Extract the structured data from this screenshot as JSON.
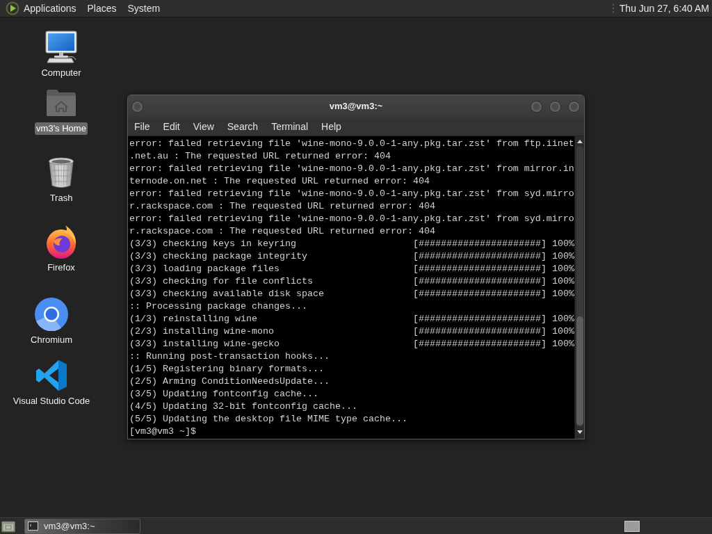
{
  "top_panel": {
    "menus": [
      "Applications",
      "Places",
      "System"
    ],
    "clock": "Thu Jun 27, 6:40 AM"
  },
  "desktop_icons": [
    {
      "label": "Computer",
      "selected": false
    },
    {
      "label": "vm3's Home",
      "selected": true
    },
    {
      "label": "Trash",
      "selected": false
    },
    {
      "label": "Firefox",
      "selected": false
    },
    {
      "label": "Chromium",
      "selected": false
    },
    {
      "label": "Visual Studio Code",
      "selected": false
    }
  ],
  "terminal_window": {
    "title": "vm3@vm3:~",
    "menu": [
      "File",
      "Edit",
      "View",
      "Search",
      "Terminal",
      "Help"
    ],
    "lines": [
      {
        "kind": "text",
        "text": "error: failed retrieving file 'wine-mono-9.0.0-1-any.pkg.tar.zst' from ftp.iinet"
      },
      {
        "kind": "text",
        "text": ".net.au : The requested URL returned error: 404"
      },
      {
        "kind": "text",
        "text": "error: failed retrieving file 'wine-mono-9.0.0-1-any.pkg.tar.zst' from mirror.in"
      },
      {
        "kind": "text",
        "text": "ternode.on.net : The requested URL returned error: 404"
      },
      {
        "kind": "text",
        "text": "error: failed retrieving file 'wine-mono-9.0.0-1-any.pkg.tar.zst' from syd.mirro"
      },
      {
        "kind": "text",
        "text": "r.rackspace.com : The requested URL returned error: 404"
      },
      {
        "kind": "text",
        "text": "error: failed retrieving file 'wine-mono-9.0.0-1-any.pkg.tar.zst' from syd.mirro"
      },
      {
        "kind": "text",
        "text": "r.rackspace.com : The requested URL returned error: 404"
      },
      {
        "kind": "progress",
        "label": "(3/3) checking keys in keyring",
        "bar": "[######################]",
        "percent": "100%"
      },
      {
        "kind": "progress",
        "label": "(3/3) checking package integrity",
        "bar": "[######################]",
        "percent": "100%"
      },
      {
        "kind": "progress",
        "label": "(3/3) loading package files",
        "bar": "[######################]",
        "percent": "100%"
      },
      {
        "kind": "progress",
        "label": "(3/3) checking for file conflicts",
        "bar": "[######################]",
        "percent": "100%"
      },
      {
        "kind": "progress",
        "label": "(3/3) checking available disk space",
        "bar": "[######################]",
        "percent": "100%"
      },
      {
        "kind": "text",
        "text": ":: Processing package changes..."
      },
      {
        "kind": "progress",
        "label": "(1/3) reinstalling wine",
        "bar": "[######################]",
        "percent": "100%"
      },
      {
        "kind": "progress",
        "label": "(2/3) installing wine-mono",
        "bar": "[######################]",
        "percent": "100%"
      },
      {
        "kind": "progress",
        "label": "(3/3) installing wine-gecko",
        "bar": "[######################]",
        "percent": "100%"
      },
      {
        "kind": "text",
        "text": ":: Running post-transaction hooks..."
      },
      {
        "kind": "text",
        "text": "(1/5) Registering binary formats..."
      },
      {
        "kind": "text",
        "text": "(2/5) Arming ConditionNeedsUpdate..."
      },
      {
        "kind": "text",
        "text": "(3/5) Updating fontconfig cache..."
      },
      {
        "kind": "text",
        "text": "(4/5) Updating 32-bit fontconfig cache..."
      },
      {
        "kind": "text",
        "text": "(5/5) Updating the desktop file MIME type cache..."
      },
      {
        "kind": "text",
        "text": "[vm3@vm3 ~]$"
      }
    ]
  },
  "bottom_panel": {
    "tasks": [
      {
        "label": "vm3@vm3:~",
        "selected": true
      }
    ]
  }
}
